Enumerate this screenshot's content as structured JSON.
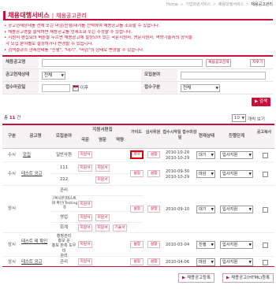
{
  "breadcrumb": {
    "home": "Home",
    "items": [
      "기업회원서비스",
      "채용대행서비스"
    ],
    "current": "채용공고관리",
    "sep": ">"
  },
  "title": {
    "main": "채용대행서비스",
    "sub": "채용공고관리"
  },
  "notes": [
    "공고현재상태를 전체 또는 마감/진행/대기를 선택하여 채용공고를 조회할 수 있습니다.",
    "채용공고명을 클릭하면 채용공고를 상세조회 또는 수정할 수 있습니다.",
    "지원서 편집요의 버튼을 누르면 채용공고에 설정되어 있는 국문지원서, 영문지원서, 역량기술서의 양식을",
    "각 모집 분야별로 설정하거나 변경할 수 있습니다.",
    "검색결과의 현재상태를 \"진행\", \"대기\", \"마감\"의 상태로 변경할 수 있습니다."
  ],
  "filter": {
    "name_label": "채용공고명",
    "name_value": "",
    "btn_search_name": "채용공고검색",
    "btn_clear": "지우기",
    "status_label": "공고현재상태",
    "status_value": "전체",
    "field_label": "모집분야",
    "field_value": "",
    "deadline_label": "접수마감일",
    "deadline_value": "",
    "after_text": "이후",
    "type_label": "접수구분",
    "type_value": "전체"
  },
  "search_button": "검색",
  "count": {
    "prefix": "총",
    "value": "11",
    "suffix": "건"
  },
  "per_page": {
    "value": "10",
    "label": "개씩 보기"
  },
  "columns": {
    "type": "구분",
    "name": "공고명",
    "field": "모집분야",
    "app_edit": "지원서편집",
    "kor": "국문",
    "eng": "영문",
    "comp": "역량",
    "guide": "가이드",
    "judge": "심사위원",
    "period": "접수시작일 접수마감일",
    "status": "현재상태",
    "progress": "진행단계",
    "copy": "공고복사"
  },
  "tags": {
    "kor": "지원서",
    "eng": "지원서",
    "comp": "기술서",
    "guide": "설정",
    "judge": "설정"
  },
  "rows": [
    {
      "type": "수시",
      "name": "모집",
      "fields": [
        "일반사원"
      ],
      "start": "2010-10-20",
      "end": "2010-10-29",
      "status": "대기",
      "progress": "입사지원"
    },
    {
      "type": "수시",
      "name": "테스트 공고",
      "fields": [
        "111",
        "222"
      ],
      "start": "2010-09-30",
      "end": "2010-10-29",
      "status": "마감",
      "progress": "입사지원"
    },
    {
      "type": "상시",
      "name": "",
      "fields": [
        "관리",
        "[복사본]테스트 태 확인(Testing 용",
        "영업",
        "회계"
      ],
      "start": "",
      "end": "2010-09-10",
      "status": "대기",
      "progress": "입사지원"
    },
    {
      "type": "상시",
      "name": "테스트 테 확인",
      "fields": [
        "행정관리",
        "홍보 운",
        "홍보 판촉 도우미",
        "관리"
      ],
      "start": "",
      "end": "2010-03-04",
      "status": "진행",
      "progress": "입사지원"
    },
    {
      "type": "상시",
      "name": "테스트 공고",
      "fields": [
        "관리"
      ],
      "start": "",
      "end": "2010-04-06",
      "status": "마감",
      "progress": "입사지원"
    }
  ],
  "bottom": {
    "register": "채용공고등록",
    "register_html": "채용공고(HTML)등록"
  },
  "colors": {
    "accent": "#c8103a",
    "highlight": "#e00000"
  }
}
